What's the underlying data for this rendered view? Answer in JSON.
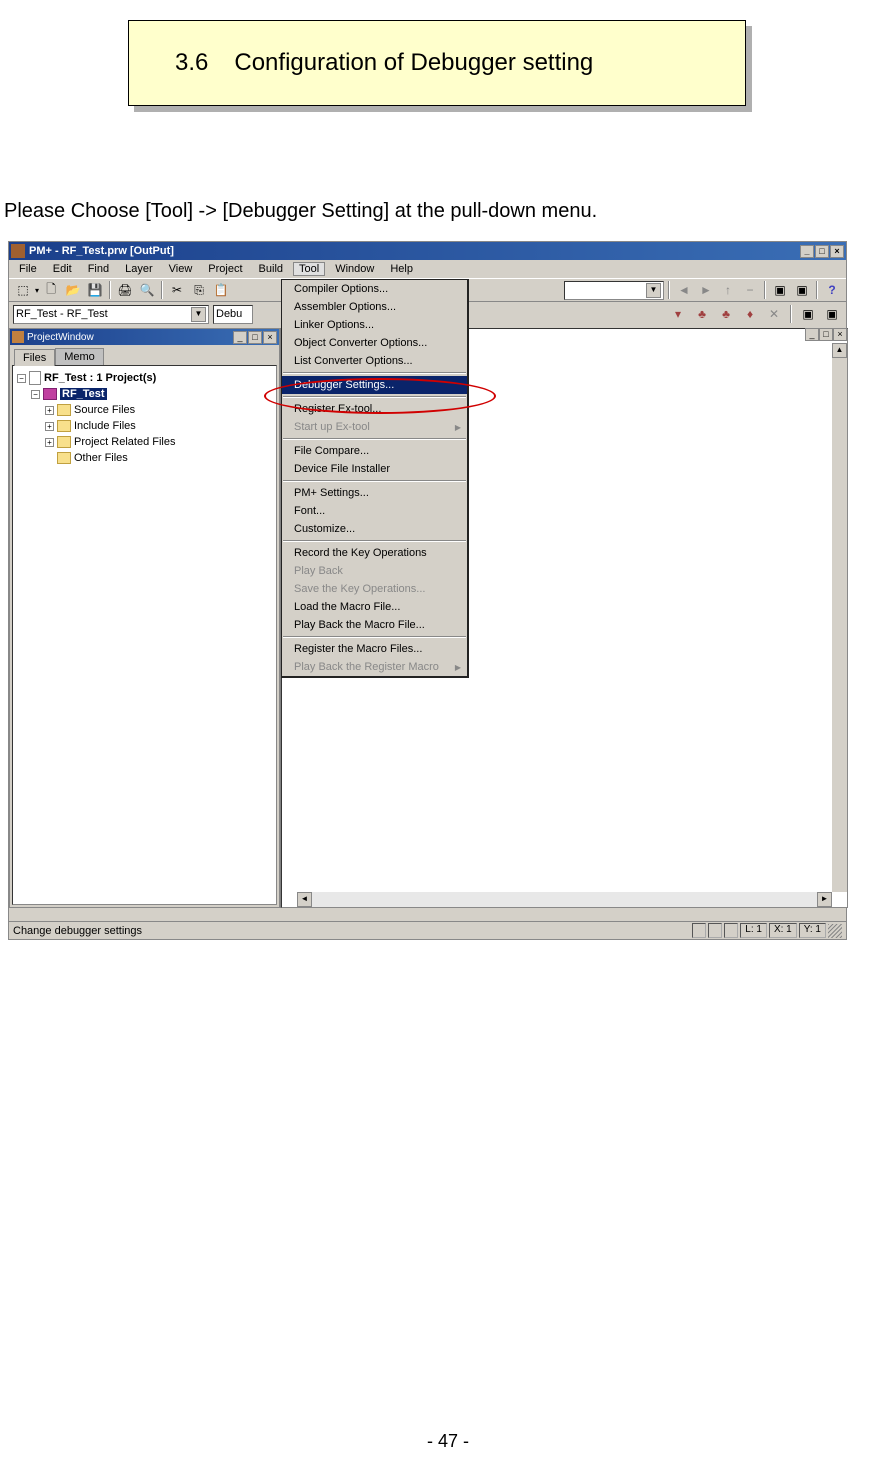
{
  "heading": {
    "num": "3.6",
    "title": "Configuration of Debugger setting"
  },
  "instruction": "Please Choose [Tool] -> [Debugger Setting] at the pull-down menu.",
  "window_title": "PM+ - RF_Test.prw [OutPut]",
  "menubar": [
    "File",
    "Edit",
    "Find",
    "Layer",
    "View",
    "Project",
    "Build",
    "Tool",
    "Window",
    "Help"
  ],
  "combo1": "RF_Test - RF_Test",
  "combo2": "Debu",
  "project_window": {
    "title": "ProjectWindow",
    "tabs": [
      "Files",
      "Memo"
    ],
    "root": "RF_Test : 1 Project(s)",
    "project_name": "RF_Test",
    "items": [
      "Source Files",
      "Include Files",
      "Project Related Files",
      "Other Files"
    ]
  },
  "dropdown": {
    "groups": [
      [
        {
          "label": "Compiler Options...",
          "disabled": false
        },
        {
          "label": "Assembler Options...",
          "disabled": false
        },
        {
          "label": "Linker Options...",
          "disabled": false
        },
        {
          "label": "Object Converter Options...",
          "disabled": false
        },
        {
          "label": "List Converter Options...",
          "disabled": false
        }
      ],
      [
        {
          "label": "Debugger Settings...",
          "highlight": true
        }
      ],
      [
        {
          "label": "Register Ex-tool...",
          "disabled": false
        },
        {
          "label": "Start up Ex-tool",
          "disabled": true,
          "submenu": true
        }
      ],
      [
        {
          "label": "File Compare...",
          "disabled": false
        },
        {
          "label": "Device File Installer",
          "disabled": false
        }
      ],
      [
        {
          "label": "PM+ Settings...",
          "disabled": false
        },
        {
          "label": "Font...",
          "disabled": false
        },
        {
          "label": "Customize...",
          "disabled": false
        }
      ],
      [
        {
          "label": "Record the Key Operations",
          "disabled": false
        },
        {
          "label": "Play Back",
          "disabled": true
        },
        {
          "label": "Save the Key Operations...",
          "disabled": true
        },
        {
          "label": "Load the Macro File...",
          "disabled": false
        },
        {
          "label": "Play Back the Macro File...",
          "disabled": false
        }
      ],
      [
        {
          "label": "Register the Macro Files...",
          "disabled": false
        },
        {
          "label": "Play Back the Register Macro",
          "disabled": true,
          "submenu": true
        }
      ]
    ]
  },
  "statusbar": {
    "message": "Change debugger settings",
    "l": "L: 1",
    "x": "X: 1",
    "y": "Y: 1"
  },
  "page_number": "- 47 -"
}
